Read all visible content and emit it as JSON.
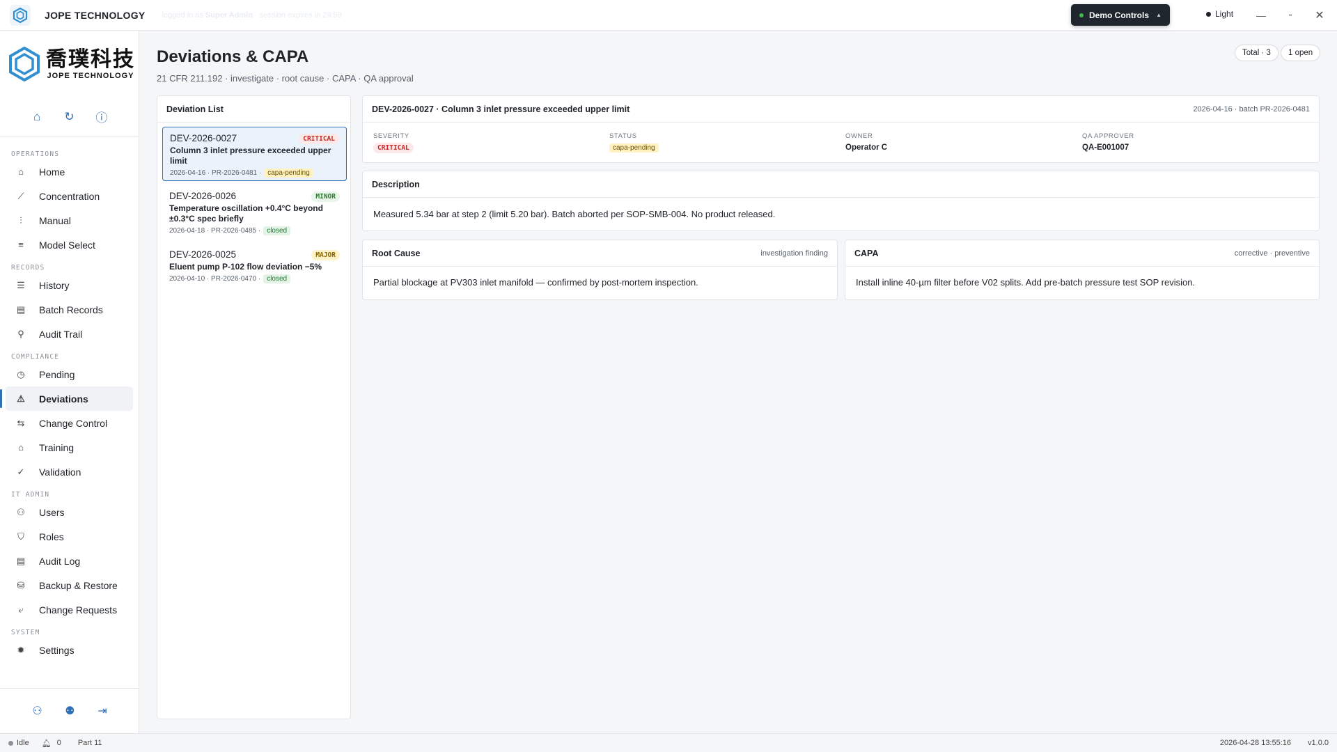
{
  "titlebar": {
    "brand": "JOPE TECHNOLOGY",
    "session_prefix": "logged in as",
    "session_user": "Super Admin",
    "session_suffix": "· session expires in 29:59",
    "demo_controls": "Demo Controls",
    "theme": "Light",
    "icons": [
      "jope-logo-icon",
      "minimize-icon",
      "maximize-icon",
      "close-icon"
    ]
  },
  "logo": {
    "cn": "喬璞科技",
    "en": "JOPE TECHNOLOGY"
  },
  "sidebar": {
    "quick_icons": [
      "home-icon",
      "refresh-icon",
      "help-icon"
    ],
    "sections": [
      {
        "label": "OPERATIONS",
        "items": [
          {
            "label": "Home",
            "icon": "⌂"
          },
          {
            "label": "Concentration",
            "icon": "⟋"
          },
          {
            "label": "Manual",
            "icon": "⫶"
          },
          {
            "label": "Model Select",
            "icon": "≡"
          }
        ]
      },
      {
        "label": "RECORDS",
        "items": [
          {
            "label": "History",
            "icon": "☰"
          },
          {
            "label": "Batch Records",
            "icon": "▤"
          },
          {
            "label": "Audit Trail",
            "icon": "⚲"
          }
        ]
      },
      {
        "label": "COMPLIANCE",
        "items": [
          {
            "label": "Pending",
            "icon": "◷"
          },
          {
            "label": "Deviations",
            "icon": "⚠",
            "active": true
          },
          {
            "label": "Change Control",
            "icon": "⇆"
          },
          {
            "label": "Training",
            "icon": "⌂"
          },
          {
            "label": "Validation",
            "icon": "✓"
          }
        ]
      },
      {
        "label": "IT ADMIN",
        "items": [
          {
            "label": "Users",
            "icon": "⚇"
          },
          {
            "label": "Roles",
            "icon": "⛉"
          },
          {
            "label": "Audit Log",
            "icon": "▤"
          },
          {
            "label": "Backup & Restore",
            "icon": "⛁"
          },
          {
            "label": "Change Requests",
            "icon": "⤶"
          }
        ]
      },
      {
        "label": "SYSTEM",
        "items": [
          {
            "label": "Settings",
            "icon": "✹"
          }
        ]
      }
    ],
    "bottom_icons": [
      "user-icon",
      "switch-user-icon",
      "logout-icon"
    ]
  },
  "page": {
    "title": "Deviations & CAPA",
    "subtitle": "21 CFR 211.192 · investigate · root cause · CAPA · QA approval",
    "total": "Total · 3",
    "open": "1 open"
  },
  "list": {
    "title": "Deviation List",
    "items": [
      {
        "id": "DEV-2026-0027",
        "severity": "CRITICAL",
        "title": "Column 3 inlet pressure exceeded upper limit",
        "date": "2026-04-16",
        "batch": "PR-2026-0481",
        "status": "capa-pending"
      },
      {
        "id": "DEV-2026-0026",
        "severity": "MINOR",
        "title": "Temperature oscillation +0.4°C beyond ±0.3°C spec briefly",
        "date": "2026-04-18",
        "batch": "PR-2026-0485",
        "status": "closed"
      },
      {
        "id": "DEV-2026-0025",
        "severity": "MAJOR",
        "title": "Eluent pump P-102 flow deviation −5%",
        "date": "2026-04-10",
        "batch": "PR-2026-0470",
        "status": "closed"
      }
    ]
  },
  "detail": {
    "header": "DEV-2026-0027 · Column 3 inlet pressure exceeded upper limit",
    "header_meta": "2026-04-16 · batch PR-2026-0481",
    "severity_label": "SEVERITY",
    "severity": "CRITICAL",
    "status_label": "STATUS",
    "status": "capa-pending",
    "owner_label": "OWNER",
    "owner": "Operator C",
    "approver_label": "QA APPROVER",
    "approver": "QA-E001007",
    "description_title": "Description",
    "description": "Measured 5.34 bar at step 2 (limit 5.20 bar). Batch aborted per SOP-SMB-004. No product released.",
    "root_cause_title": "Root Cause",
    "root_cause_meta": "investigation finding",
    "root_cause": "Partial blockage at PV303 inlet manifold — confirmed by post-mortem inspection.",
    "capa_title": "CAPA",
    "capa_meta": "corrective · preventive",
    "capa": "Install inline 40-µm filter before V02 splits. Add pre-batch pressure test SOP revision."
  },
  "statusbar": {
    "state": "Idle",
    "notifications": "0",
    "mode": "Part 11",
    "datetime": "2026-04-28 13:55:16",
    "version": "v1.0.0"
  }
}
